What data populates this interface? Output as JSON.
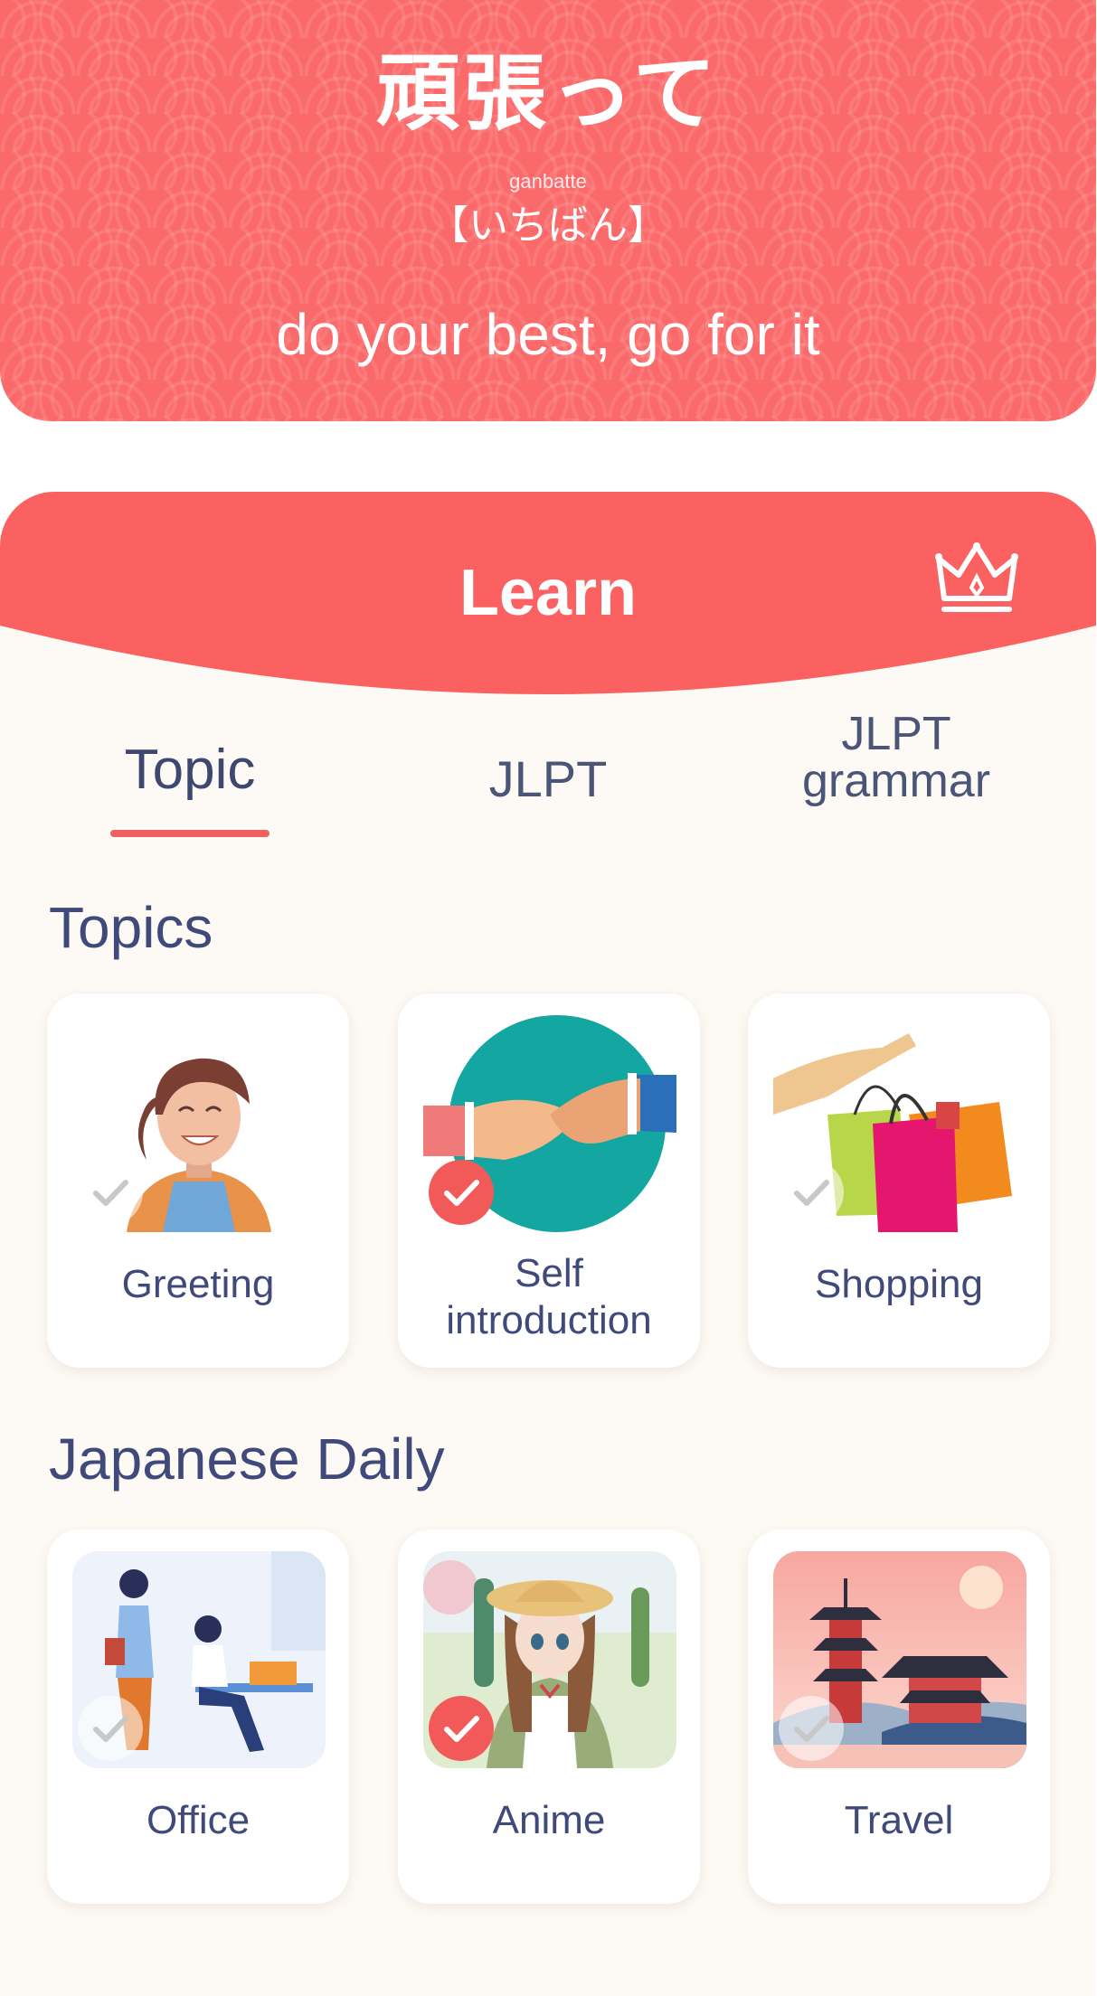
{
  "word_of_day": {
    "kanji": "頑張って",
    "romaji": "ganbatte",
    "kana": "【いちばん】",
    "meaning": "do your best, go for it"
  },
  "learn": {
    "title": "Learn",
    "premium_icon": "crown-icon",
    "tabs": [
      {
        "label": "Topic",
        "selected": true
      },
      {
        "label": "JLPT",
        "selected": false
      },
      {
        "label": "JLPT\ngrammar",
        "selected": false
      }
    ]
  },
  "sections": [
    {
      "title": "Topics",
      "cards": [
        {
          "label": "Greeting",
          "image": "woman-smiling",
          "completed": false
        },
        {
          "label": "Self\nintroduction",
          "image": "handshake",
          "completed": true
        },
        {
          "label": "Shopping",
          "image": "shopping-bags",
          "completed": false
        }
      ]
    },
    {
      "title": "Japanese Daily",
      "cards": [
        {
          "label": "Office",
          "image": "office-workers",
          "completed": false
        },
        {
          "label": "Anime",
          "image": "anime-girl",
          "completed": true
        },
        {
          "label": "Travel",
          "image": "pagoda-landscape",
          "completed": false
        }
      ]
    }
  ],
  "colors": {
    "accent": "#fb6a6a",
    "text": "#3f4a7a",
    "panel_bg": "#fdf9f4",
    "check_done": "#f25a5a"
  }
}
